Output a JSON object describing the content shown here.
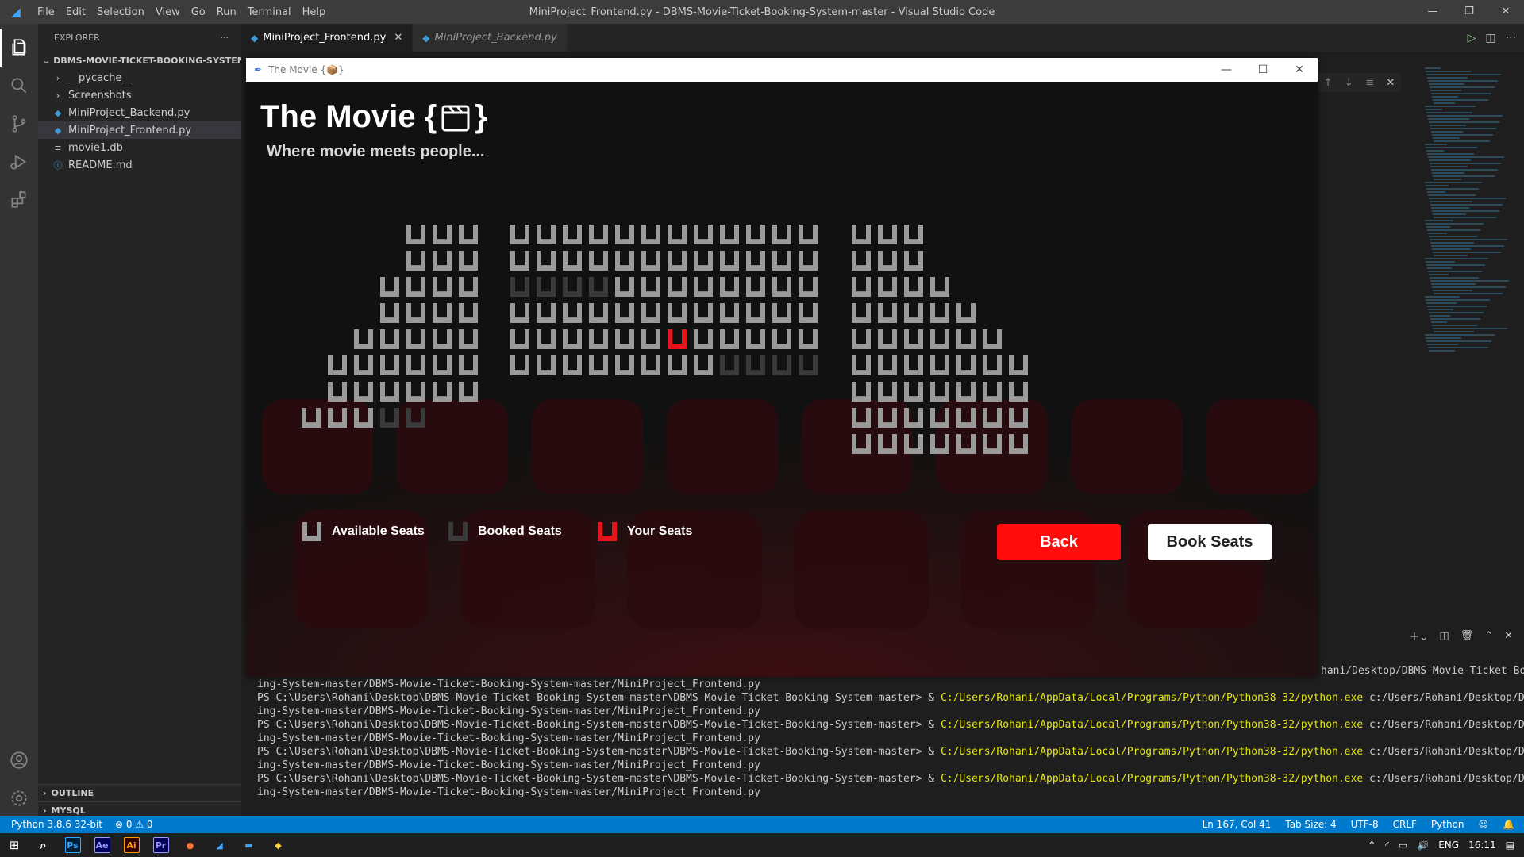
{
  "vscode": {
    "menu": [
      "File",
      "Edit",
      "Selection",
      "View",
      "Go",
      "Run",
      "Terminal",
      "Help"
    ],
    "window_title": "MiniProject_Frontend.py - DBMS-Movie-Ticket-Booking-System-master - Visual Studio Code",
    "explorer": {
      "header": "EXPLORER",
      "more": "···",
      "folder": "DBMS-MOVIE-TICKET-BOOKING-SYSTEM-...",
      "items": [
        {
          "label": "__pycache__",
          "icon": "chevron-right-icon",
          "glyph": "›"
        },
        {
          "label": "Screenshots",
          "icon": "chevron-right-icon",
          "glyph": "›"
        },
        {
          "label": "MiniProject_Backend.py",
          "icon": "python-file-icon",
          "glyph": "◆"
        },
        {
          "label": "MiniProject_Frontend.py",
          "icon": "python-file-icon",
          "glyph": "◆"
        },
        {
          "label": "movie1.db",
          "icon": "database-file-icon",
          "glyph": "≡"
        },
        {
          "label": "README.md",
          "icon": "info-file-icon",
          "glyph": "ⓘ"
        }
      ],
      "outline": "OUTLINE",
      "mysql": "MYSQL"
    },
    "tabs": [
      {
        "label": "MiniProject_Frontend.py",
        "active": true
      },
      {
        "label": "MiniProject_Backend.py",
        "active": false
      }
    ],
    "terminal_lines": [
      {
        "plain": "ing-System-master/DBMS-Movie-Ticket-Booking-System-master/MiniProject_Frontend.py",
        "exe": "",
        "rest": ""
      },
      {
        "plain": "PS C:\\Users\\Rohani\\Desktop\\DBMS-Movie-Ticket-Booking-System-master\\DBMS-Movie-Ticket-Booking-System-master> & ",
        "exe": "C:/Users/Rohani/AppData/Local/Programs/Python/Python38-32/python.exe",
        "rest": " c:/Users/Rohani/Desktop/DBMS-Movie-Ticket-Book"
      },
      {
        "plain": "ing-System-master/DBMS-Movie-Ticket-Booking-System-master/MiniProject_Frontend.py",
        "exe": "",
        "rest": ""
      },
      {
        "plain": "PS C:\\Users\\Rohani\\Desktop\\DBMS-Movie-Ticket-Booking-System-master\\DBMS-Movie-Ticket-Booking-System-master> & ",
        "exe": "C:/Users/Rohani/AppData/Local/Programs/Python/Python38-32/python.exe",
        "rest": " c:/Users/Rohani/Desktop/DBMS-Movie-Ticket-Book"
      },
      {
        "plain": "ing-System-master/DBMS-Movie-Ticket-Booking-System-master/MiniProject_Frontend.py",
        "exe": "",
        "rest": ""
      },
      {
        "plain": "PS C:\\Users\\Rohani\\Desktop\\DBMS-Movie-Ticket-Booking-System-master\\DBMS-Movie-Ticket-Booking-System-master> & ",
        "exe": "C:/Users/Rohani/AppData/Local/Programs/Python/Python38-32/python.exe",
        "rest": " c:/Users/Rohani/Desktop/DBMS-Movie-Ticket-Book"
      },
      {
        "plain": "ing-System-master/DBMS-Movie-Ticket-Booking-System-master/MiniProject_Frontend.py",
        "exe": "",
        "rest": ""
      },
      {
        "plain": "PS C:\\Users\\Rohani\\Desktop\\DBMS-Movie-Ticket-Booking-System-master\\DBMS-Movie-Ticket-Booking-System-master> & ",
        "exe": "C:/Users/Rohani/AppData/Local/Programs/Python/Python38-32/python.exe",
        "rest": " c:/Users/Rohani/Desktop/DBMS-Movie-Ticket-Book"
      },
      {
        "plain": "ing-System-master/DBMS-Movie-Ticket-Booking-System-master/MiniProject_Frontend.py",
        "exe": "",
        "rest": ""
      }
    ],
    "terminal_right_top": "hani/Desktop/DBMS-Movie-Ticket-Book",
    "status": {
      "python": "Python 3.8.6 32-bit",
      "problems": "⊗ 0 ⚠ 0",
      "position": "Ln 167, Col 41",
      "tab_size": "Tab Size: 4",
      "encoding": "UTF-8",
      "eol": "CRLF",
      "language": "Python"
    },
    "taskbar": {
      "apps": [
        {
          "label": "Ps",
          "name": "photoshop-icon",
          "color": "#31a8ff",
          "bg": "#001e36"
        },
        {
          "label": "Ae",
          "name": "after-effects-icon",
          "color": "#9999ff",
          "bg": "#00005b"
        },
        {
          "label": "Ai",
          "name": "illustrator-icon",
          "color": "#ff9a00",
          "bg": "#330000"
        },
        {
          "label": "Pr",
          "name": "premiere-icon",
          "color": "#9999ff",
          "bg": "#00005b"
        },
        {
          "label": "●",
          "name": "firefox-icon",
          "color": "#ff7139",
          "bg": "transparent"
        },
        {
          "label": "◢",
          "name": "vscode-taskbar-icon",
          "color": "#3ea6ff",
          "bg": "transparent"
        },
        {
          "label": "▬",
          "name": "app-window-icon",
          "color": "#4aa0e6",
          "bg": "transparent"
        },
        {
          "label": "◆",
          "name": "python-app-icon",
          "color": "#ffd43b",
          "bg": "transparent"
        }
      ],
      "language": "ENG",
      "time": "16:11"
    }
  },
  "app": {
    "window_title": "The Movie {📦}",
    "title": "The Movie {",
    "title_close": "}",
    "subtitle": "Where movie meets people...",
    "colors": {
      "available": "#9a9a9a",
      "booked": "#3a3a3a",
      "yours": "#e8141b",
      "back_button": "#ff0d0d"
    },
    "legend": {
      "available": "Available Seats",
      "booked": "Booked Seats",
      "yours": "Your Seats"
    },
    "buttons": {
      "back": "Back",
      "book": "Book Seats"
    },
    "seat_rows": [
      {
        "left": "AAA",
        "middle": "AAAAAAAAAAAA",
        "right": "AAA"
      },
      {
        "left": "AAA",
        "middle": "AAAAAAAAAAAA",
        "right": "AAA"
      },
      {
        "left": "AAAA",
        "middle": "BBBBAAAAAAAA",
        "right": "AAAA"
      },
      {
        "left": "AAAA",
        "middle": "AAAAAAAAAAAA",
        "right": "AAAAA"
      },
      {
        "left": "AAAAA",
        "middle": "AAAAAAYAAAAA",
        "right": "AAAAAA"
      },
      {
        "left": "AAAAAA",
        "middle": "AAAAAAAABBBB",
        "right": "AAAAAAA"
      },
      {
        "left": "AAAAAA",
        "middle": "",
        "right": "AAAAAAA"
      },
      {
        "left": "AAABB",
        "middle": "",
        "right": "AAAAAAA"
      },
      {
        "left": "",
        "middle": "",
        "right": "AAAAAAA"
      }
    ]
  }
}
